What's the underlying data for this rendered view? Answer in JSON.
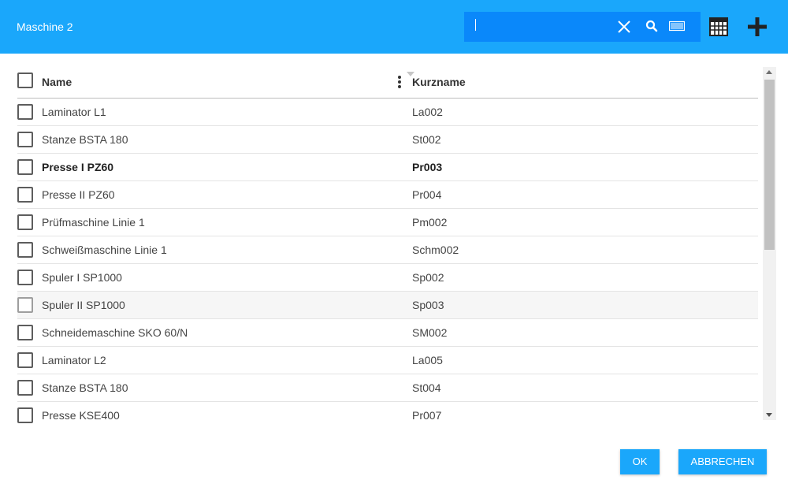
{
  "dialog": {
    "title": "Maschine 2"
  },
  "search": {
    "value": "",
    "placeholder": ""
  },
  "icons": {
    "clear": "close-icon",
    "search": "search-icon",
    "barcode": "barcode-icon",
    "table": "table-icon",
    "add": "plus-icon"
  },
  "table": {
    "columns": [
      {
        "label": "Name"
      },
      {
        "label": "Kurzname"
      }
    ],
    "rows": [
      {
        "name": "Laminator L1",
        "short": "La002"
      },
      {
        "name": "Stanze BSTA 180",
        "short": "St002"
      },
      {
        "name": "Presse I PZ60",
        "short": "Pr003"
      },
      {
        "name": "Presse II PZ60",
        "short": "Pr004"
      },
      {
        "name": "Prüfmaschine Linie 1",
        "short": "Pm002"
      },
      {
        "name": "Schweißmaschine Linie 1",
        "short": "Schm002"
      },
      {
        "name": "Spuler I SP1000",
        "short": "Sp002"
      },
      {
        "name": "Spuler II SP1000",
        "short": "Sp003"
      },
      {
        "name": "Schneidemaschine SKO 60/N",
        "short": "SM002"
      },
      {
        "name": "Laminator L2",
        "short": "La005"
      },
      {
        "name": "Stanze BSTA 180",
        "short": "St004"
      },
      {
        "name": "Presse KSE400",
        "short": "Pr007"
      }
    ]
  },
  "footer": {
    "ok_label": "OK",
    "cancel_label": "ABBRECHEN"
  },
  "colors": {
    "header": "#1aa7fb",
    "search_bg": "#0a88fa",
    "button": "#1aa7fb"
  }
}
